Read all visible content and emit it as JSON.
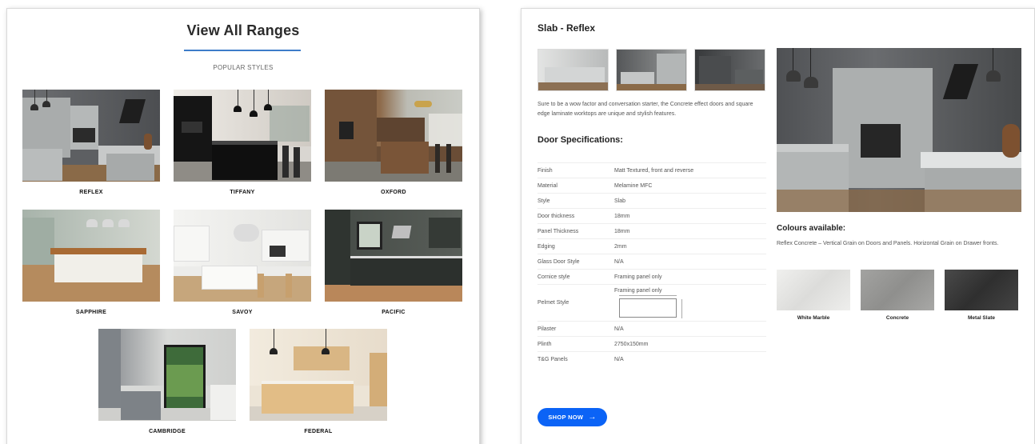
{
  "ranges": {
    "title": "View All Ranges",
    "subtitle": "POPULAR STYLES",
    "items": [
      {
        "label": "REFLEX"
      },
      {
        "label": "TIFFANY"
      },
      {
        "label": "OXFORD"
      },
      {
        "label": "SAPPHIRE"
      },
      {
        "label": "SAVOY"
      },
      {
        "label": "PACIFIC"
      },
      {
        "label": "CAMBRIDGE"
      },
      {
        "label": "FEDERAL"
      }
    ]
  },
  "product": {
    "title": "Slab - Reflex",
    "description": "Sure to be a wow factor and conversation starter, the Concrete effect doors and square edge laminate worktops are unique and stylish features.",
    "specs_heading": "Door Specifications:",
    "specs": [
      {
        "key": "Finish",
        "value": "Matt Textured, front and reverse"
      },
      {
        "key": "Material",
        "value": "Melamine MFC"
      },
      {
        "key": "Style",
        "value": "Slab"
      },
      {
        "key": "Door thickness",
        "value": "18mm"
      },
      {
        "key": "Panel Thickness",
        "value": "18mm"
      },
      {
        "key": "Edging",
        "value": "2mm"
      },
      {
        "key": "Glass Door Style",
        "value": "N/A"
      },
      {
        "key": "Cornice style",
        "value": "Framing panel only"
      },
      {
        "key": "Pelmet Style",
        "value": "Framing panel only"
      },
      {
        "key": "Pilaster",
        "value": "N/A"
      },
      {
        "key": "Plinth",
        "value": "2750x150mm"
      },
      {
        "key": "T&G Panels",
        "value": "N/A"
      }
    ],
    "shop_label": "SHOP NOW",
    "colours_heading": "Colours available:",
    "colours_desc": "Reflex Concrete – Vertical Grain on Doors and Panels. Horizontal Grain on Drawer fronts.",
    "swatches": [
      {
        "label": "White Marble",
        "color": "#e6e6e4"
      },
      {
        "label": "Concrete",
        "color": "#9a9a98"
      },
      {
        "label": "Metal Slate",
        "color": "#3e3e3e"
      }
    ]
  },
  "colors": {
    "accent_blue": "#0b63f6",
    "underline_blue": "#3d7cc9"
  }
}
